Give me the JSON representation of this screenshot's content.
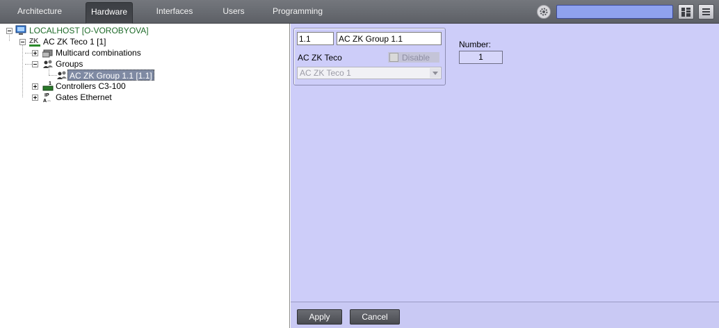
{
  "top_tabs": [
    "Architecture",
    "Hardware",
    "Interfaces",
    "Users",
    "Programming"
  ],
  "active_tab": "Hardware",
  "search": {
    "value": ""
  },
  "tree": {
    "root": "LOCALHOST [O-VOROBYOVA]",
    "device": "AC ZK Teco 1 [1]",
    "multicard": "Multicard combinations",
    "groups": "Groups",
    "group_item": "AC ZK Group 1.1 [1.1]",
    "controllers": "Controllers C3-100",
    "gates": "Gates Ethernet"
  },
  "icons": {
    "root": "computer-icon",
    "device": "zk-logo-icon",
    "multicard": "cards-icon",
    "groups": "users-icon",
    "group_item": "users-icon",
    "controllers": "controller-icon",
    "gates": "ip-gate-icon"
  },
  "form": {
    "id_value": "1.1",
    "name_value": "AC ZK Group 1.1",
    "parent_label": "AC ZK Teco",
    "disable_label": "Disable",
    "disable_checked": false,
    "parent_select": "AC ZK Teco 1",
    "number_label": "Number:",
    "number_value": "1"
  },
  "buttons": {
    "apply": "Apply",
    "cancel": "Cancel"
  },
  "colors": {
    "panel": "#cdcdf9",
    "topbar": "#676a70",
    "accent": "#8fa2ee",
    "root_text": "#1f6b2a"
  }
}
